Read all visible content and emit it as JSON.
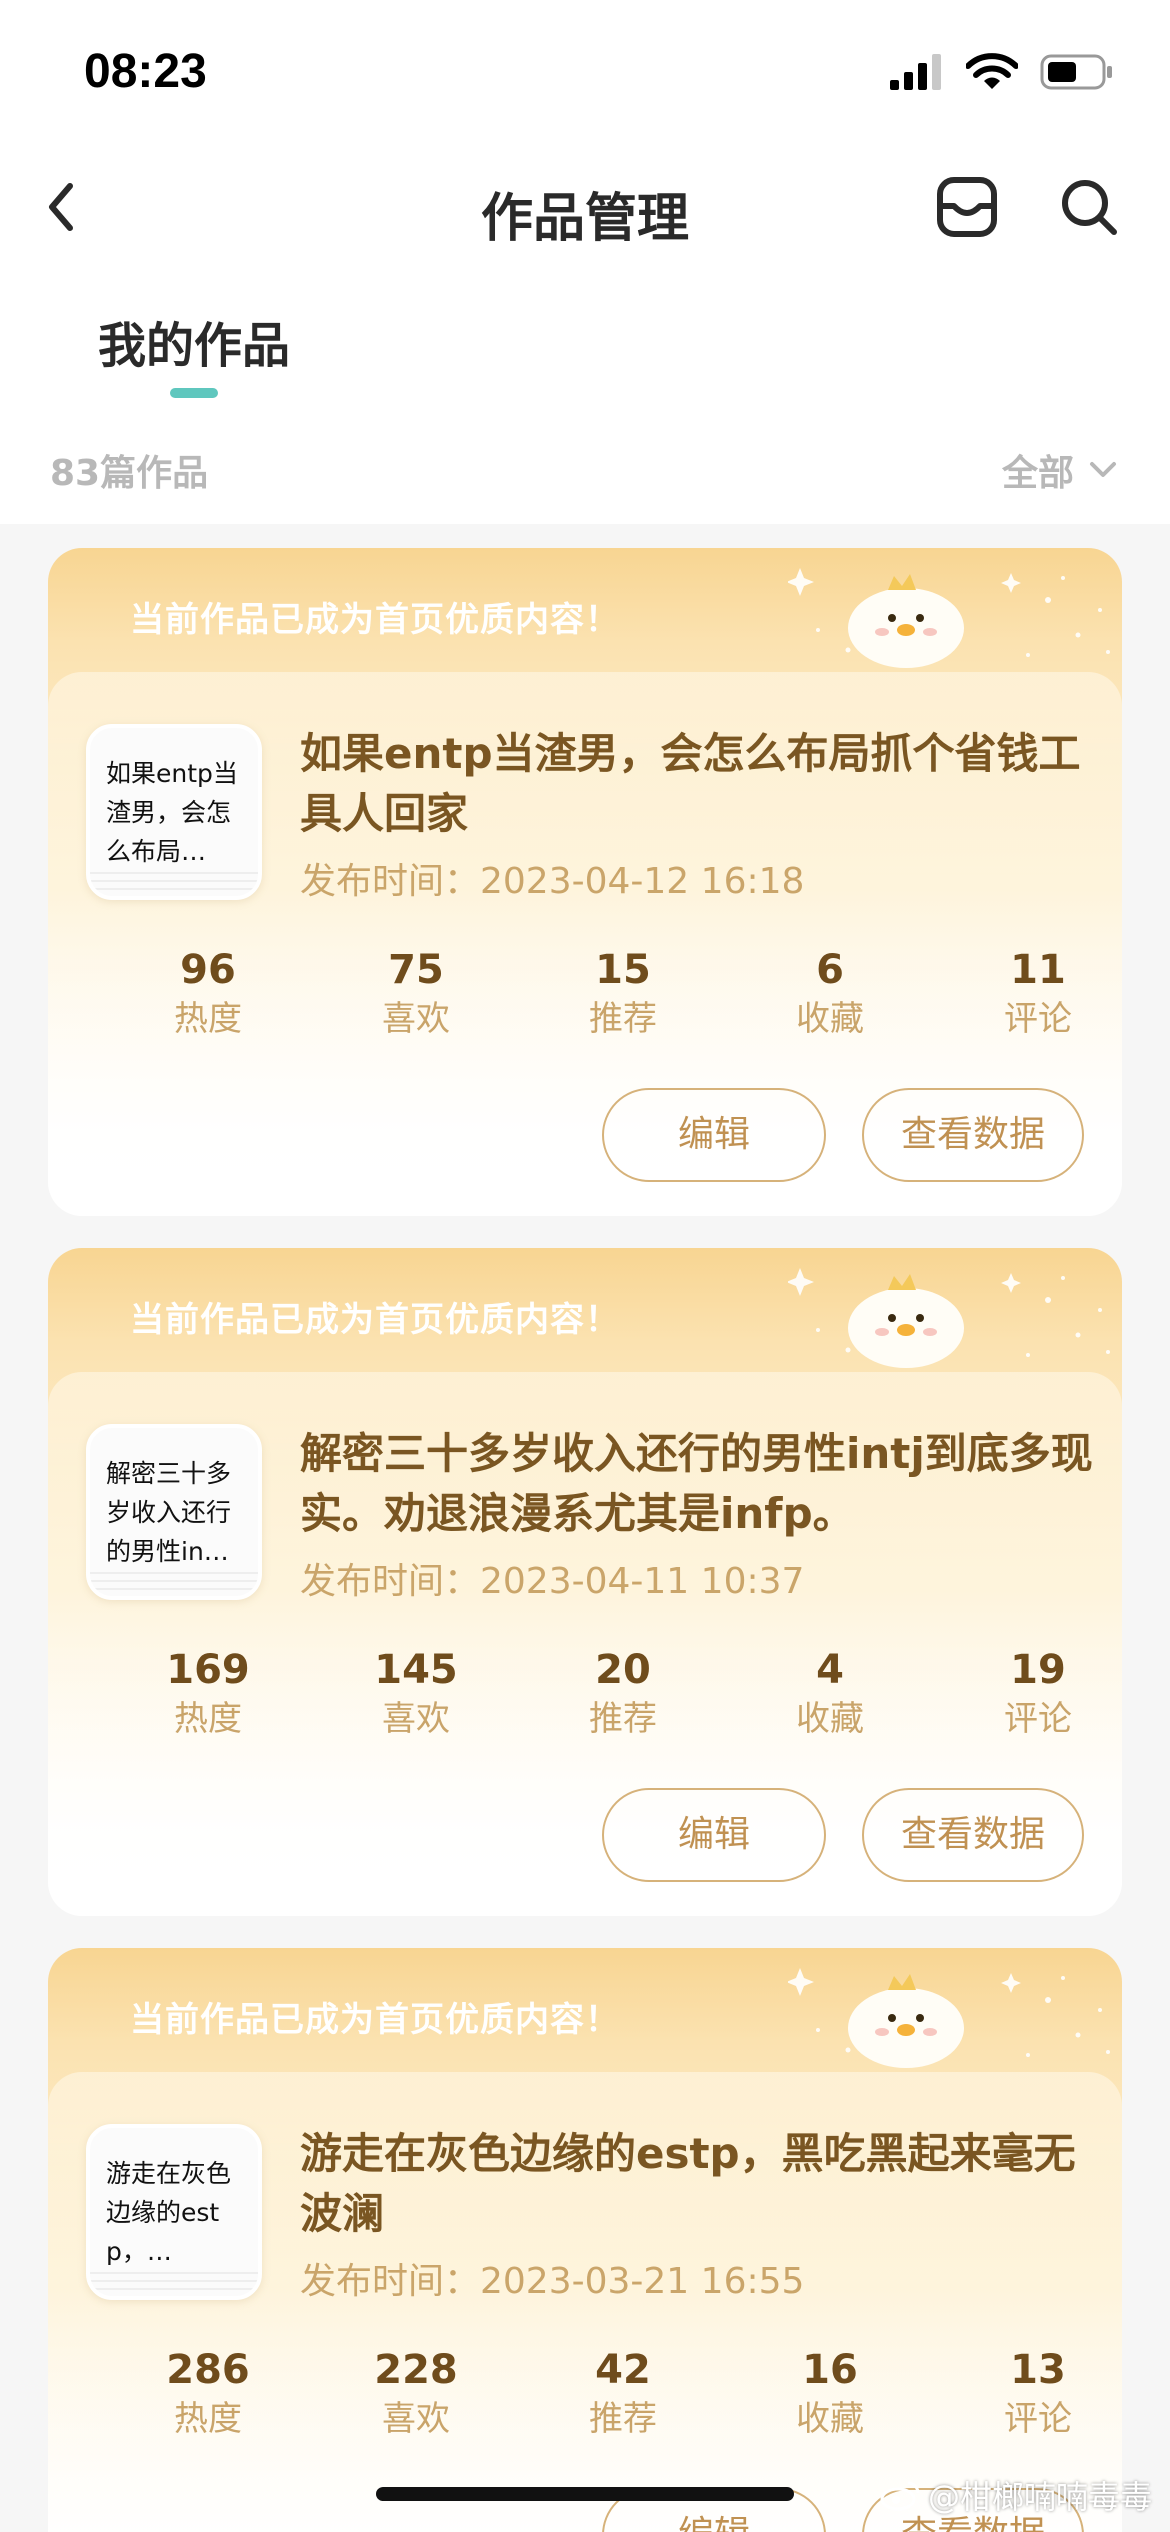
{
  "status_bar": {
    "time": "08:23"
  },
  "nav": {
    "title": "作品管理"
  },
  "tabs": [
    {
      "label": "我的作品",
      "active": true
    }
  ],
  "summary": {
    "count_label": "83篇作品",
    "filter_label": "全部"
  },
  "works": [
    {
      "banner": "当前作品已成为首页优质内容！",
      "thumb_text": "如果entp当渣男，会怎么布局…",
      "title": "如果entp当渣男，会怎么布局抓个省钱工具人回家",
      "publish_time": "发布时间：2023-04-12 16:18",
      "stats": [
        {
          "value": "96",
          "label": "热度"
        },
        {
          "value": "75",
          "label": "喜欢"
        },
        {
          "value": "15",
          "label": "推荐"
        },
        {
          "value": "6",
          "label": "收藏"
        },
        {
          "value": "11",
          "label": "评论"
        }
      ],
      "edit_label": "编辑",
      "data_label": "查看数据"
    },
    {
      "banner": "当前作品已成为首页优质内容！",
      "thumb_text": "解密三十多岁收入还行的男性in…",
      "title": "解密三十多岁收入还行的男性intj到底多现实。劝退浪漫系尤其是infp。",
      "publish_time": "发布时间：2023-04-11 10:37",
      "stats": [
        {
          "value": "169",
          "label": "热度"
        },
        {
          "value": "145",
          "label": "喜欢"
        },
        {
          "value": "20",
          "label": "推荐"
        },
        {
          "value": "4",
          "label": "收藏"
        },
        {
          "value": "19",
          "label": "评论"
        }
      ],
      "edit_label": "编辑",
      "data_label": "查看数据"
    },
    {
      "banner": "当前作品已成为首页优质内容！",
      "thumb_text": "游走在灰色边缘的estp，…",
      "title": "游走在灰色边缘的estp，黑吃黑起来毫无波澜",
      "publish_time": "发布时间：2023-03-21 16:55",
      "stats": [
        {
          "value": "286",
          "label": "热度"
        },
        {
          "value": "228",
          "label": "喜欢"
        },
        {
          "value": "42",
          "label": "推荐"
        },
        {
          "value": "16",
          "label": "收藏"
        },
        {
          "value": "13",
          "label": "评论"
        }
      ],
      "edit_label": "编辑",
      "data_label": "查看数据"
    }
  ],
  "watermark": "@柑榔喃喃毒毒",
  "colors": {
    "accent": "#5fc7be",
    "card_gold": "#f8d592",
    "title_brown": "#7a5622",
    "muted_gold": "#c9a46a"
  },
  "icons": [
    "chevron-left-icon",
    "inbox-icon",
    "search-icon",
    "signal-icon",
    "wifi-icon",
    "battery-icon",
    "chevron-down-icon",
    "mascot-chick-icon"
  ]
}
